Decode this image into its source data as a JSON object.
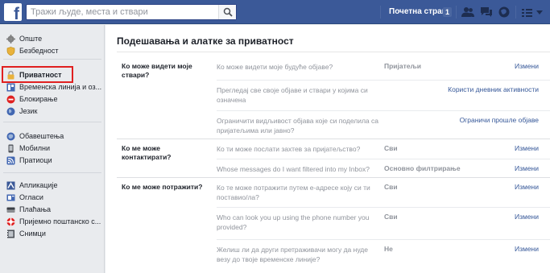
{
  "topbar": {
    "logo": "f",
    "search_placeholder": "Тражи људе, места и ствари",
    "home_label": "Почетна страна",
    "home_count": "1",
    "icons": [
      "friend-requests-icon",
      "messages-icon",
      "notifications-icon",
      "privacy-shortcuts-icon"
    ],
    "colors": {
      "bar": "#3b5998",
      "link": "#365899"
    }
  },
  "sidebar": {
    "group1": [
      {
        "label": "Опште",
        "icon": "gear-icon"
      },
      {
        "label": "Безбедност",
        "icon": "shield-icon"
      }
    ],
    "group2": [
      {
        "label": "Приватност",
        "icon": "lock-icon",
        "active": true
      },
      {
        "label": "Временска линија и оз...",
        "icon": "timeline-icon"
      },
      {
        "label": "Блокирање",
        "icon": "block-icon"
      },
      {
        "label": "Језик",
        "icon": "globe-icon"
      }
    ],
    "group3": [
      {
        "label": "Обавештења",
        "icon": "notifications-globe-icon"
      },
      {
        "label": "Мобилни",
        "icon": "mobile-icon"
      },
      {
        "label": "Пратиоци",
        "icon": "rss-icon"
      }
    ],
    "group4": [
      {
        "label": "Апликације",
        "icon": "apps-icon"
      },
      {
        "label": "Огласи",
        "icon": "ads-icon"
      },
      {
        "label": "Плаћања",
        "icon": "payments-icon"
      },
      {
        "label": "Пријемно поштанско с...",
        "icon": "support-inbox-icon"
      },
      {
        "label": "Снимци",
        "icon": "videos-icon"
      }
    ]
  },
  "main": {
    "title": "Подешавања и алатке за приватност",
    "sections": [
      {
        "label": "Ко може видети моје ствари?",
        "rows": [
          {
            "question": "Ко може видети моје будуће објаве?",
            "value": "Пријатељи",
            "action": "Измени"
          },
          {
            "question": "Прегледај све своје објаве и ствари у којима си означена",
            "value": "",
            "action": "Користи дневник активности"
          },
          {
            "question": "Ограничити видљивост објава које си поделила са пријатељима или јавно?",
            "value": "",
            "action": "Ограничи прошле објаве"
          }
        ]
      },
      {
        "label": "Ко ме може контактирати?",
        "rows": [
          {
            "question": "Ко ти може послати захтев за пријатељство?",
            "value": "Сви",
            "action": "Измени"
          },
          {
            "question": "Whose messages do I want filtered into my Inbox?",
            "value": "Основно филтрирање",
            "action": "Измени"
          }
        ]
      },
      {
        "label": "Ко ме може потражити?",
        "rows": [
          {
            "question": "Ко те може потражити путем е-адресе коју си ти поставио/ла?",
            "value": "Сви",
            "action": "Измени"
          },
          {
            "question": "Who can look you up using the phone number you provided?",
            "value": "Сви",
            "action": "Измени"
          },
          {
            "question": "Желиш ли да други претраживачи могу да нуде везу до твоје временске линије?",
            "value": "Не",
            "action": "Измени"
          }
        ]
      }
    ]
  }
}
